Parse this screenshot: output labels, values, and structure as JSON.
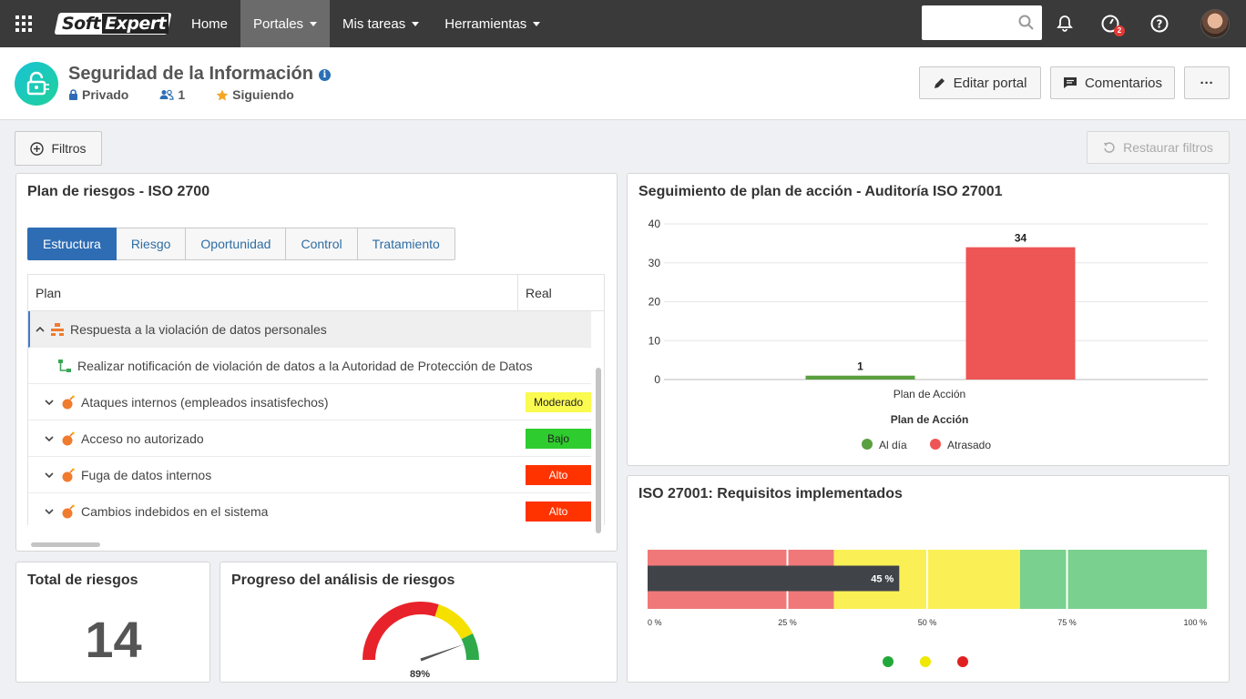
{
  "nav": {
    "items": [
      {
        "label": "Home",
        "active": false,
        "dropdown": false
      },
      {
        "label": "Portales",
        "active": true,
        "dropdown": true
      },
      {
        "label": "Mis tareas",
        "active": false,
        "dropdown": true
      },
      {
        "label": "Herramientas",
        "active": false,
        "dropdown": true
      }
    ],
    "logo_left": "Soft",
    "logo_right": "Expert",
    "task_badge": "2"
  },
  "header": {
    "title": "Seguridad de la Información",
    "privacy": "Privado",
    "members": "1",
    "following": "Siguiendo",
    "edit_label": "Editar portal",
    "comments_label": "Comentarios",
    "more_label": "···"
  },
  "filters": {
    "filter_label": "Filtros",
    "restore_label": "Restaurar filtros"
  },
  "risk_plan": {
    "title": "Plan de riesgos - ISO 2700",
    "tabs": [
      "Estructura",
      "Riesgo",
      "Oportunidad",
      "Control",
      "Tratamiento"
    ],
    "active_tab": "Estructura",
    "columns": [
      "Plan",
      "Real"
    ],
    "rows": [
      {
        "label": "Respuesta a la violación de datos personales",
        "level": "",
        "level_color": ""
      },
      {
        "label": "Realizar notificación de violación de datos a la Autoridad de Protección de Datos",
        "level": "",
        "level_color": ""
      },
      {
        "label": "Ataques internos (empleados insatisfechos)",
        "level": "Moderado",
        "level_color": "#fafa50"
      },
      {
        "label": "Acceso no autorizado",
        "level": "Bajo",
        "level_color": "#2ecc2e"
      },
      {
        "label": "Fuga de datos internos",
        "level": "Alto",
        "level_color": "#ff3300"
      },
      {
        "label": "Cambios indebidos en el sistema",
        "level": "Alto",
        "level_color": "#ff3300"
      }
    ]
  },
  "action_plan": {
    "title": "Seguimiento de plan de acción - Auditoría ISO 27001"
  },
  "requirements": {
    "title": "ISO 27001: Requisitos implementados"
  },
  "total": {
    "title": "Total de riesgos",
    "value": "14"
  },
  "progress": {
    "title": "Progreso del análisis de riesgos",
    "value": 89,
    "label": "89%"
  },
  "chart_data": [
    {
      "type": "bar",
      "title": "Seguimiento de plan de acción - Auditoría ISO 27001",
      "categories": [
        "Plan de Acción"
      ],
      "xlabel": "Plan de Acción",
      "ylabel": "",
      "ylim": [
        0,
        40
      ],
      "yticks": [
        0,
        10,
        20,
        30,
        40
      ],
      "series": [
        {
          "name": "Al día",
          "values": [
            1
          ],
          "color": "#5aa040"
        },
        {
          "name": "Atrasado",
          "values": [
            34
          ],
          "color": "#ee5555"
        }
      ],
      "legend": "bottom",
      "grid": true
    },
    {
      "type": "bar",
      "title": "ISO 27001: Requisitos implementados",
      "orientation": "horizontal",
      "value": 45,
      "value_label": "45 %",
      "xlim": [
        0,
        100
      ],
      "xticks": [
        "0 %",
        "25 %",
        "50 %",
        "75 %",
        "100 %"
      ],
      "bands": [
        {
          "from": 0,
          "to": 33.3,
          "color": "#f07878"
        },
        {
          "from": 33.3,
          "to": 66.6,
          "color": "#faf055"
        },
        {
          "from": 66.6,
          "to": 100,
          "color": "#7ad08e"
        }
      ],
      "legend_colors": [
        "#22a83a",
        "#f0e800",
        "#e02020"
      ]
    }
  ]
}
